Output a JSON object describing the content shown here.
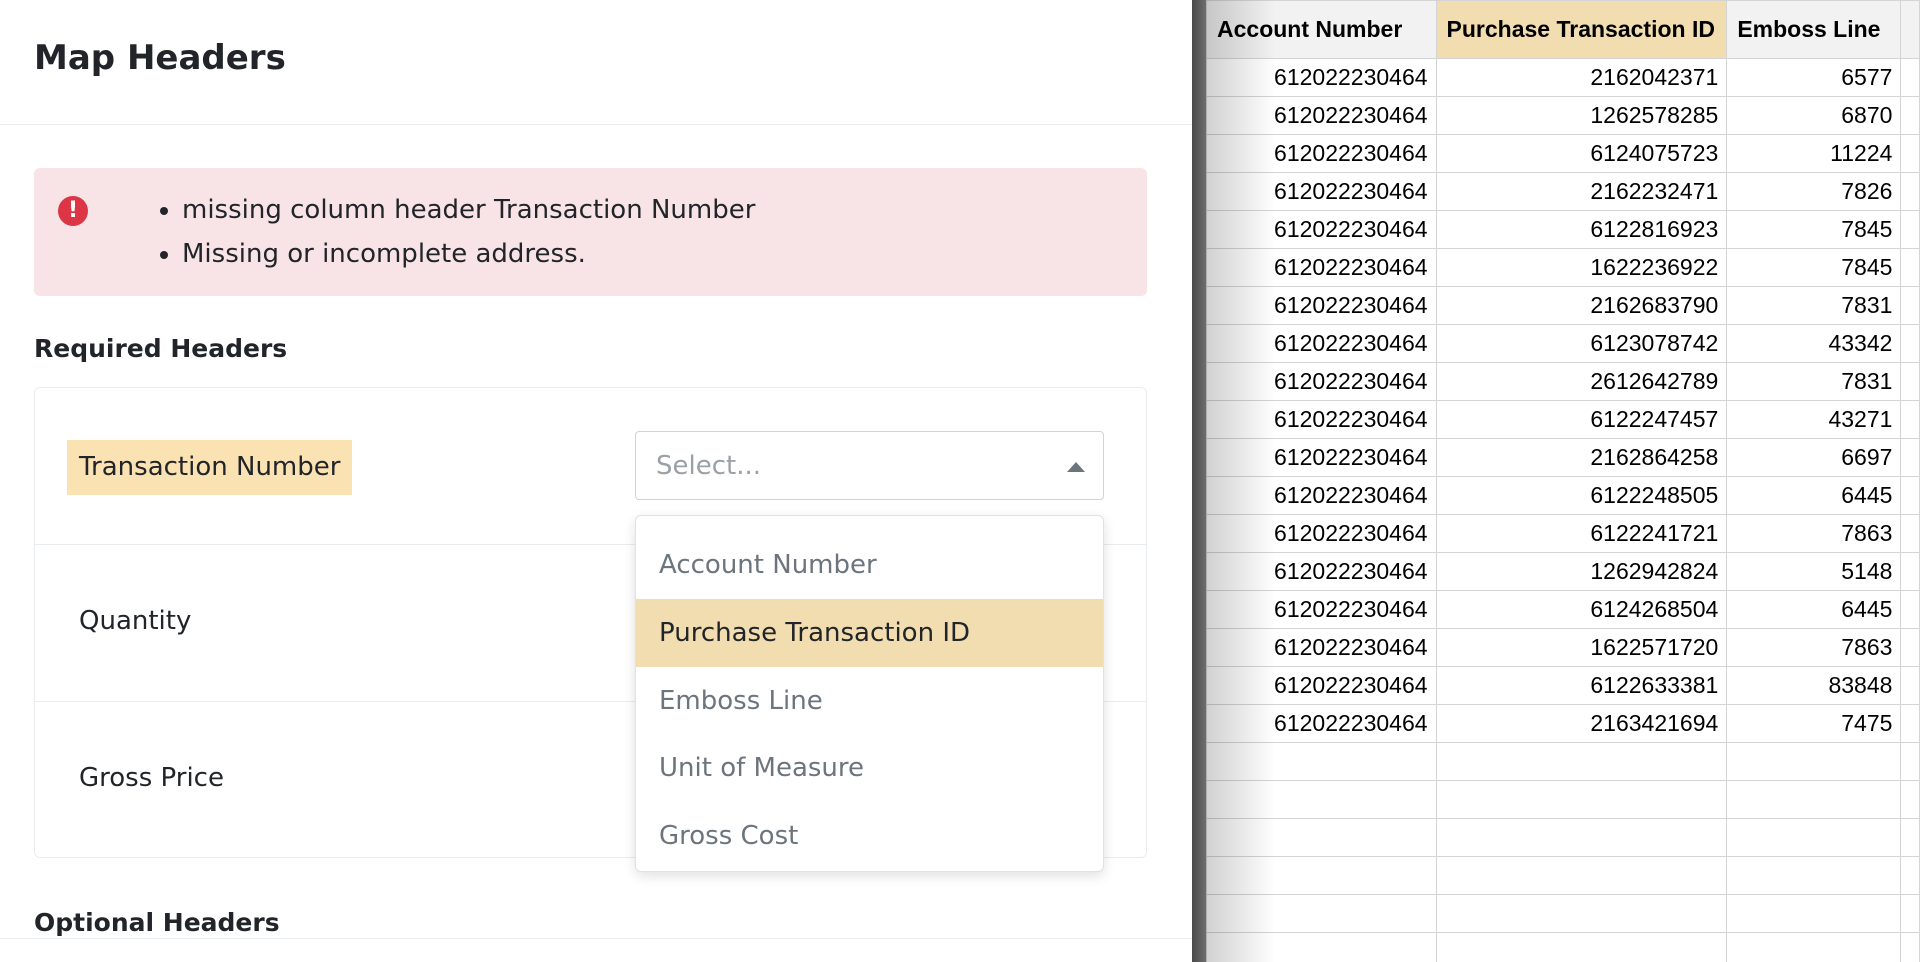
{
  "page": {
    "title": "Map Headers"
  },
  "alert": {
    "icon": "error-icon",
    "color": "#dc3545",
    "background": "#f8e4e7",
    "messages": [
      "missing column header Transaction Number",
      "Missing or incomplete address."
    ]
  },
  "required_section": {
    "title": "Required Headers",
    "rows": [
      {
        "label": "Transaction Number",
        "highlighted": true
      },
      {
        "label": "Quantity"
      },
      {
        "label": "Gross Price"
      }
    ]
  },
  "select": {
    "placeholder": "Select...",
    "open": true,
    "options": [
      "Account Number",
      "Purchase Transaction ID",
      "Emboss Line",
      "Unit of Measure",
      "Gross Cost"
    ],
    "highlighted_option": "Purchase Transaction ID"
  },
  "optional_section": {
    "title": "Optional Headers"
  },
  "colors": {
    "highlight": "#f2ddb0",
    "label_highlight": "#fbe2b2"
  },
  "spreadsheet": {
    "columns": [
      "Account Number",
      "Purchase Transaction ID",
      "Emboss Line",
      ""
    ],
    "highlighted_column": "Purchase Transaction ID",
    "rows": [
      [
        "612022230464",
        "2162042371",
        "6577"
      ],
      [
        "612022230464",
        "1262578285",
        "6870"
      ],
      [
        "612022230464",
        "6124075723",
        "11224"
      ],
      [
        "612022230464",
        "2162232471",
        "7826"
      ],
      [
        "612022230464",
        "6122816923",
        "7845"
      ],
      [
        "612022230464",
        "1622236922",
        "7845"
      ],
      [
        "612022230464",
        "2162683790",
        "7831"
      ],
      [
        "612022230464",
        "6123078742",
        "43342"
      ],
      [
        "612022230464",
        "2612642789",
        "7831"
      ],
      [
        "612022230464",
        "6122247457",
        "43271"
      ],
      [
        "612022230464",
        "2162864258",
        "6697"
      ],
      [
        "612022230464",
        "6122248505",
        "6445"
      ],
      [
        "612022230464",
        "6122241721",
        "7863"
      ],
      [
        "612022230464",
        "1262942824",
        "5148"
      ],
      [
        "612022230464",
        "6124268504",
        "6445"
      ],
      [
        "612022230464",
        "1622571720",
        "7863"
      ],
      [
        "612022230464",
        "6122633381",
        "83848"
      ],
      [
        "612022230464",
        "2163421694",
        "7475"
      ]
    ]
  }
}
